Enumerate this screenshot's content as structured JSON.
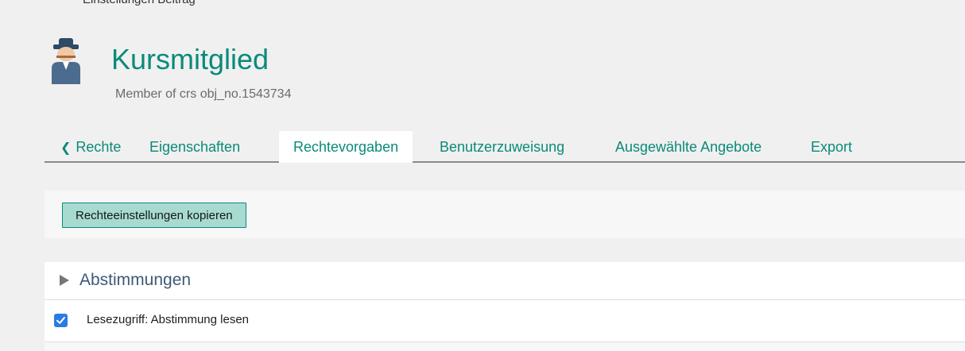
{
  "top_clipped_text": "Einstellungen Beitrag",
  "header": {
    "avatar_icon": "user-role-icon",
    "title": "Kursmitglied",
    "subtitle": "Member of crs obj_no.1543734"
  },
  "tabs": [
    {
      "label": "Rechte",
      "icon": "chevron-left-icon",
      "active": false
    },
    {
      "label": "Eigenschaften",
      "active": false
    },
    {
      "label": "Rechtevorgaben",
      "active": true
    },
    {
      "label": "Benutzerzuweisung",
      "active": false
    },
    {
      "label": "Ausgewählte Angebote",
      "active": false
    },
    {
      "label": "Export",
      "active": false
    }
  ],
  "toolbar": {
    "copy_button": "Rechteeinstellungen kopieren"
  },
  "section": {
    "title": "Abstimmungen",
    "items": [
      {
        "label": "Lesezugriff: Abstimmung lesen",
        "checked": true
      }
    ]
  },
  "colors": {
    "accent": "#0a8a7a",
    "button_bg": "#a7dbd1",
    "section_title": "#3d5a78",
    "checkbox": "#2a7be4"
  }
}
